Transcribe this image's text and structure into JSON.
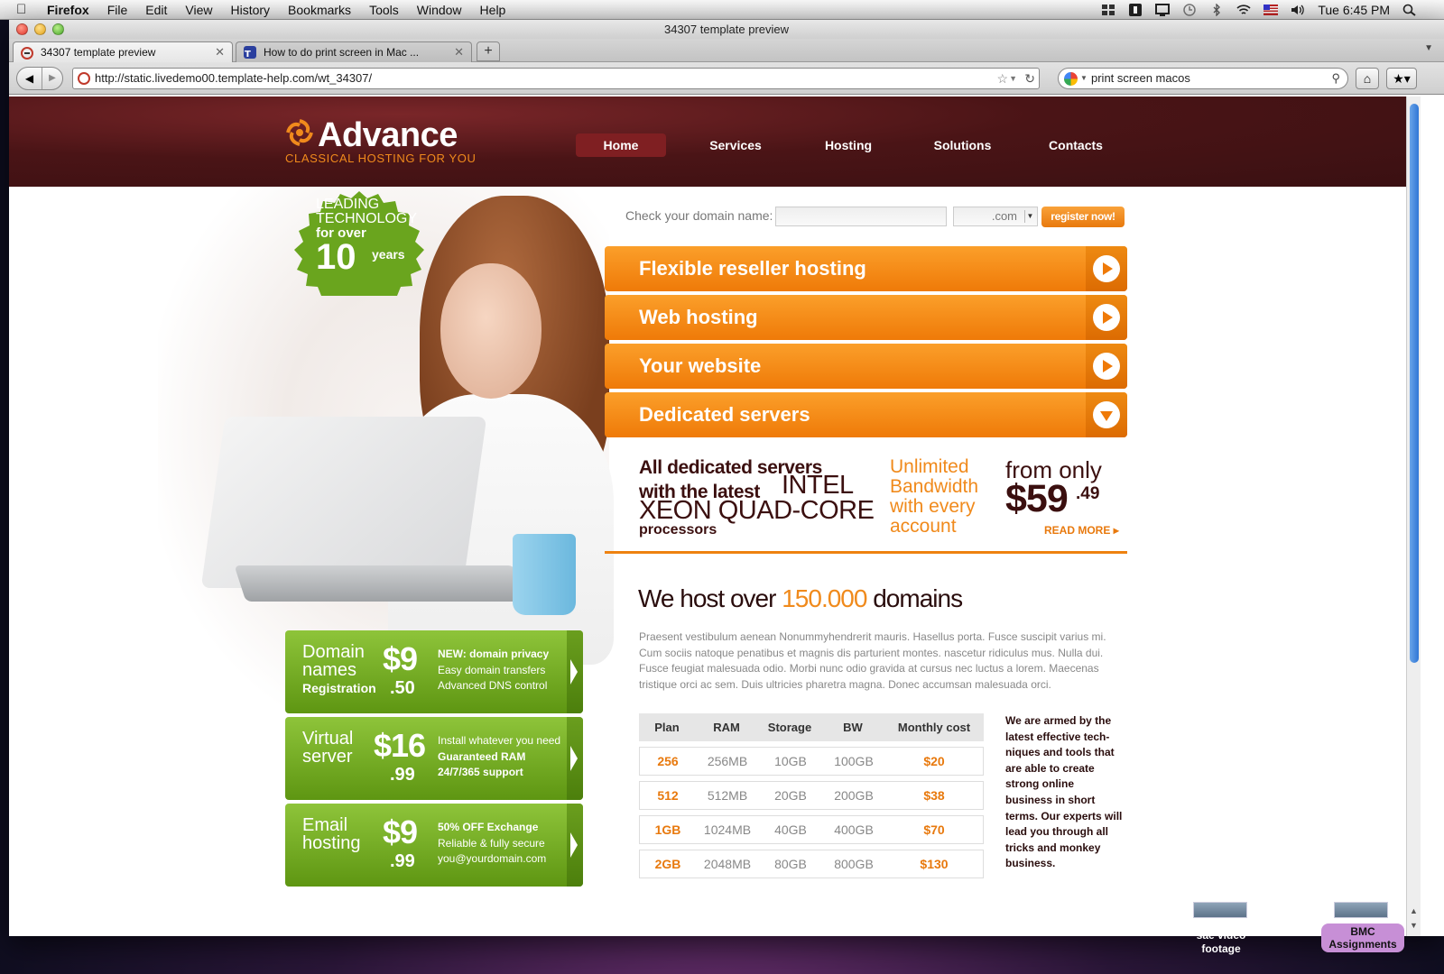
{
  "menubar": {
    "app_name": "Firefox",
    "items": [
      "File",
      "Edit",
      "View",
      "History",
      "Bookmarks",
      "Tools",
      "Window",
      "Help"
    ],
    "clock": "Tue 6:45 PM"
  },
  "window": {
    "title": "34307 template preview"
  },
  "tabs": [
    {
      "label": "34307 template preview"
    },
    {
      "label": "How to do print screen in Mac ..."
    }
  ],
  "navbar": {
    "url": "http://static.livedemo00.template-help.com/wt_34307/",
    "search_value": "print screen macos"
  },
  "site": {
    "logo": "Advance",
    "tagline": "CLASSICAL HOSTING FOR YOU",
    "nav": [
      "Home",
      "Services",
      "Hosting",
      "Solutions",
      "Contacts"
    ],
    "badge": {
      "line1": "LEADING",
      "line2": "TECHNOLOGY",
      "line3": "for over",
      "number": "10",
      "unit": "years"
    },
    "domain_check": {
      "label": "Check your domain name:",
      "input_value": "",
      "tld": ".com",
      "button": "register now!"
    },
    "accordion": [
      {
        "label": "Flexible reseller hosting",
        "state": "collapsed"
      },
      {
        "label": "Web hosting",
        "state": "collapsed"
      },
      {
        "label": "Your website",
        "state": "collapsed"
      },
      {
        "label": "Dedicated servers",
        "state": "expanded"
      }
    ],
    "dedicated": {
      "bold_line1": "All dedicated servers",
      "bold_line2": "with the latest",
      "intel": "INTEL",
      "xeon": "XEON QUAD-CORE",
      "processors": "processors",
      "unlimited": "Unlimited Bandwidth with every account",
      "from_only": "from only",
      "price": "$59",
      "price_cents": ".49",
      "read_more": "READ MORE"
    },
    "host_heading": {
      "pre": "We host over ",
      "number": "150.000",
      "post": " domains"
    },
    "lorem": "Praesent vestibulum aenean Nonummyhendrerit mauris. Hasellus porta. Fusce suscipit varius mi. Cum sociis natoque penatibus et magnis dis parturient montes. nascetur ridiculus mus. Nulla dui. Fusce feugiat malesuada odio. Morbi nunc odio gravida at cursus nec luctus a lorem. Maecenas tristique orci ac sem. Duis ultricies pharetra magna. Donec accumsan malesuada orci.",
    "plans": {
      "headers": [
        "Plan",
        "RAM",
        "Storage",
        "BW",
        "Monthly cost"
      ],
      "rows": [
        [
          "256",
          "256MB",
          "10GB",
          "100GB",
          "$20"
        ],
        [
          "512",
          "512MB",
          "20GB",
          "200GB",
          "$38"
        ],
        [
          "1GB",
          "1024MB",
          "40GB",
          "400GB",
          "$70"
        ],
        [
          "2GB",
          "2048MB",
          "80GB",
          "800GB",
          "$130"
        ]
      ]
    },
    "armed_text": "We are armed by the latest effective tech-niques and tools that are able to create strong online business in short terms. Our experts will lead you through all tricks and monkey business.",
    "promos": [
      {
        "name1": "Domain",
        "name2": "names",
        "sub": "Registration",
        "price": "$9",
        "cents": ".50",
        "feats": [
          "NEW: domain privacy",
          "Easy domain transfers",
          "Advanced DNS control"
        ]
      },
      {
        "name1": "Virtual",
        "name2": "server",
        "sub": "",
        "price": "$16",
        "cents": ".99",
        "feats": [
          "Install whatever you need",
          "Guaranteed RAM",
          "24/7/365 support"
        ]
      },
      {
        "name1": "Email",
        "name2": "hosting",
        "sub": "",
        "price": "$9",
        "cents": ".99",
        "feats": [
          "50% OFF Exchange",
          "Reliable & fully secure",
          "you@yourdomain.com"
        ]
      }
    ]
  },
  "desktop": {
    "items": [
      {
        "label": "sae video footage"
      },
      {
        "label": "BMC Assignments"
      }
    ]
  }
}
